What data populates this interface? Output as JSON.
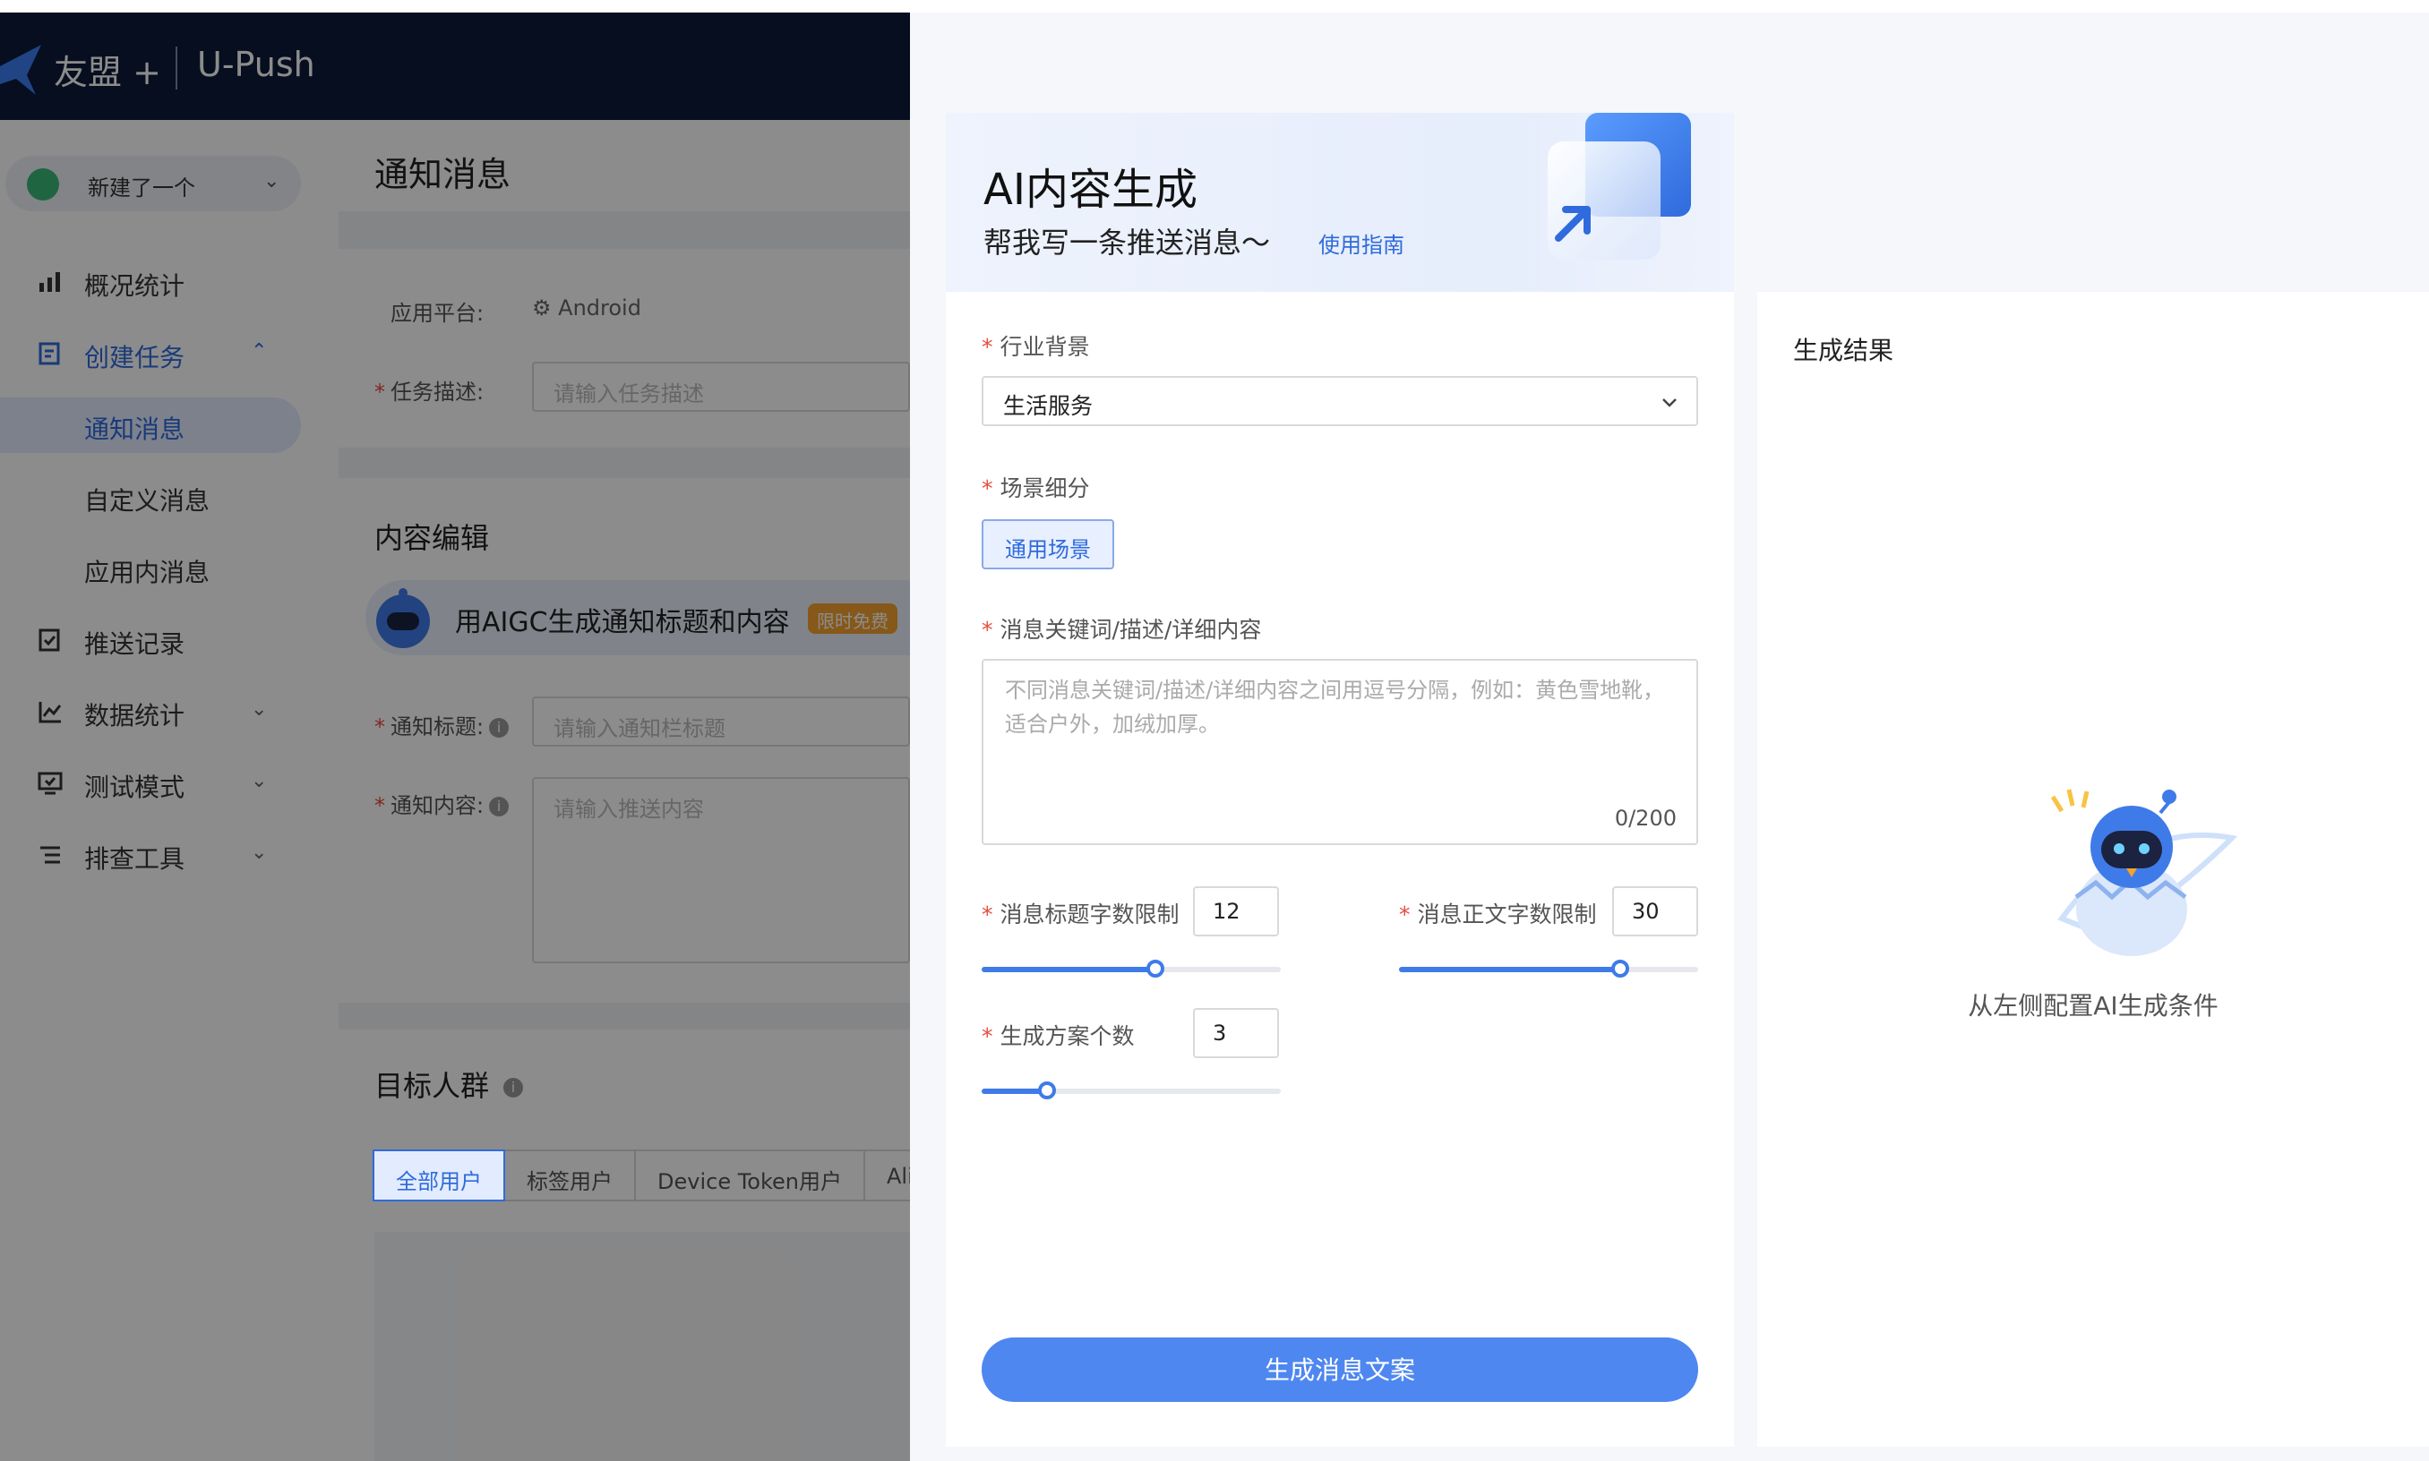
{
  "brand": {
    "name": "友盟 +",
    "product": "U-Push"
  },
  "sidebar": {
    "app_selector": "新建了一个",
    "items": [
      {
        "label": "概况统计"
      },
      {
        "label": "创建任务"
      },
      {
        "label": "推送记录"
      },
      {
        "label": "数据统计"
      },
      {
        "label": "测试模式"
      },
      {
        "label": "排查工具"
      }
    ],
    "sub_items": [
      {
        "label": "通知消息"
      },
      {
        "label": "自定义消息"
      },
      {
        "label": "应用内消息"
      }
    ]
  },
  "page": {
    "title": "通知消息",
    "platform_label": "应用平台:",
    "platform_value": "Android",
    "task_desc_label": "任务描述:",
    "task_desc_placeholder": "请输入任务描述",
    "content_section_title": "内容编辑",
    "aigc_banner_text": "用AIGC生成通知标题和内容",
    "aigc_badge": "限时免费",
    "notify_title_label": "通知标题:",
    "notify_title_placeholder": "请输入通知栏标题",
    "notify_content_label": "通知内容:",
    "notify_content_placeholder": "请输入推送内容",
    "audience_section_title": "目标人群",
    "audience_tabs": [
      "全部用户",
      "标签用户",
      "Device Token用户",
      "Ali"
    ]
  },
  "drawer": {
    "hero_title": "AI内容生成",
    "hero_subtitle": "帮我写一条推送消息～",
    "hero_link": "使用指南",
    "industry": {
      "label": "行业背景",
      "value": "生活服务"
    },
    "scene": {
      "label": "场景细分",
      "option": "通用场景"
    },
    "keywords": {
      "label": "消息关键词/描述/详细内容",
      "placeholder": "不同消息关键词/描述/详细内容之间用逗号分隔，例如：黄色雪地靴，适合户外，加绒加厚。",
      "counter": "0/200"
    },
    "title_limit": {
      "label": "消息标题字数限制",
      "value": "12",
      "fraction": 0.58
    },
    "body_limit": {
      "label": "消息正文字数限制",
      "value": "30",
      "fraction": 0.74
    },
    "plan_count": {
      "label": "生成方案个数",
      "value": "3",
      "fraction": 0.22
    },
    "generate_button": "生成消息文案",
    "result_title": "生成结果",
    "empty_hint": "从左侧配置AI生成条件"
  },
  "colors": {
    "accent": "#3f7be8",
    "topbar": "#0b1b3a",
    "required": "#e84c3d"
  }
}
